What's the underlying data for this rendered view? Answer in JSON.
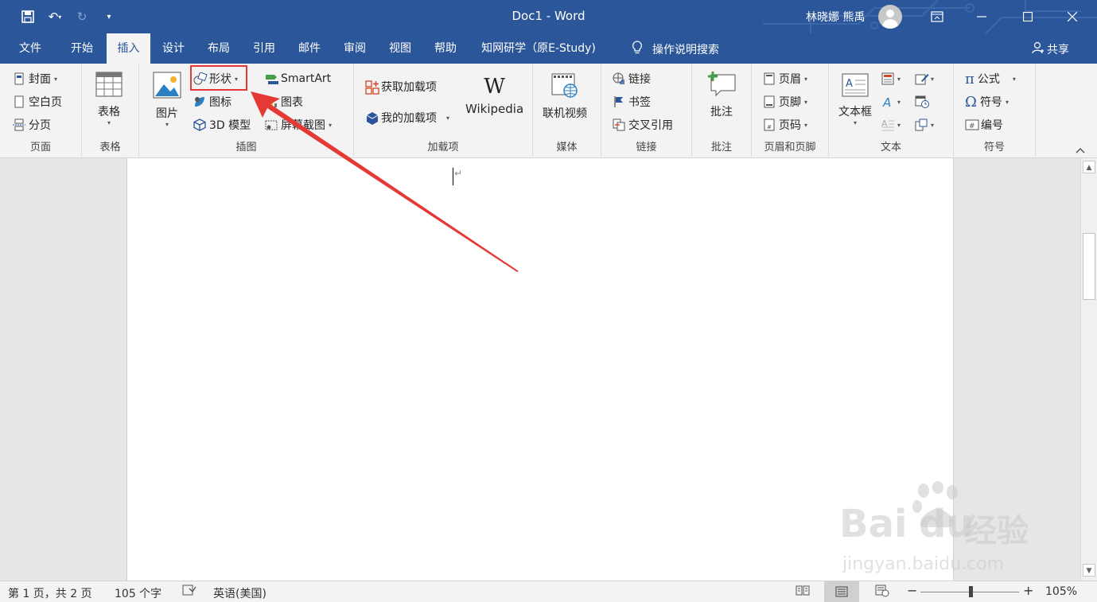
{
  "titlebar": {
    "doc_title": "Doc1  -  Word",
    "user_name": "林晓娜 熊禹"
  },
  "tabs": [
    {
      "label": "文件"
    },
    {
      "label": "开始"
    },
    {
      "label": "插入"
    },
    {
      "label": "设计"
    },
    {
      "label": "布局"
    },
    {
      "label": "引用"
    },
    {
      "label": "邮件"
    },
    {
      "label": "审阅"
    },
    {
      "label": "视图"
    },
    {
      "label": "帮助"
    },
    {
      "label": "知网研学（原E-Study)"
    }
  ],
  "active_tab": "插入",
  "tellme": {
    "label": "操作说明搜索"
  },
  "share": {
    "label": "共享"
  },
  "ribbon": {
    "pages": {
      "cover": "封面",
      "blank": "空白页",
      "break": "分页",
      "label": "页面"
    },
    "tables": {
      "table": "表格",
      "label": "表格"
    },
    "illustrations": {
      "pictures": "图片",
      "shapes": "形状",
      "icons": "图标",
      "model3d": "3D 模型",
      "smartart": "SmartArt",
      "chart": "图表",
      "screenshot": "屏幕截图",
      "label": "插图"
    },
    "addins": {
      "get": "获取加载项",
      "my": "我的加载项",
      "wikipedia": "Wikipedia",
      "label": "加载项"
    },
    "media": {
      "video": "联机视频",
      "label": "媒体"
    },
    "links": {
      "link": "链接",
      "bookmark": "书签",
      "crossref": "交叉引用",
      "label": "链接"
    },
    "comments": {
      "comment": "批注",
      "label": "批注"
    },
    "headerfooter": {
      "header": "页眉",
      "footer": "页脚",
      "pagenum": "页码",
      "label": "页眉和页脚"
    },
    "text": {
      "textbox": "文本框",
      "label": "文本"
    },
    "symbols": {
      "equation": "公式",
      "symbol": "符号",
      "number": "编号",
      "label": "符号"
    }
  },
  "document": {
    "paragraph_mark": "↵"
  },
  "statusbar": {
    "page": "第 1 页，共 2 页",
    "words": "105 个字",
    "language": "英语(美国)",
    "zoom": "105%"
  },
  "colors": {
    "accent": "#2b579a",
    "annotation": "#e53935"
  },
  "watermark": {
    "brand": "Bai",
    "brand2": "du",
    "brand3": "经验",
    "url": "jingyan.baidu.com"
  }
}
